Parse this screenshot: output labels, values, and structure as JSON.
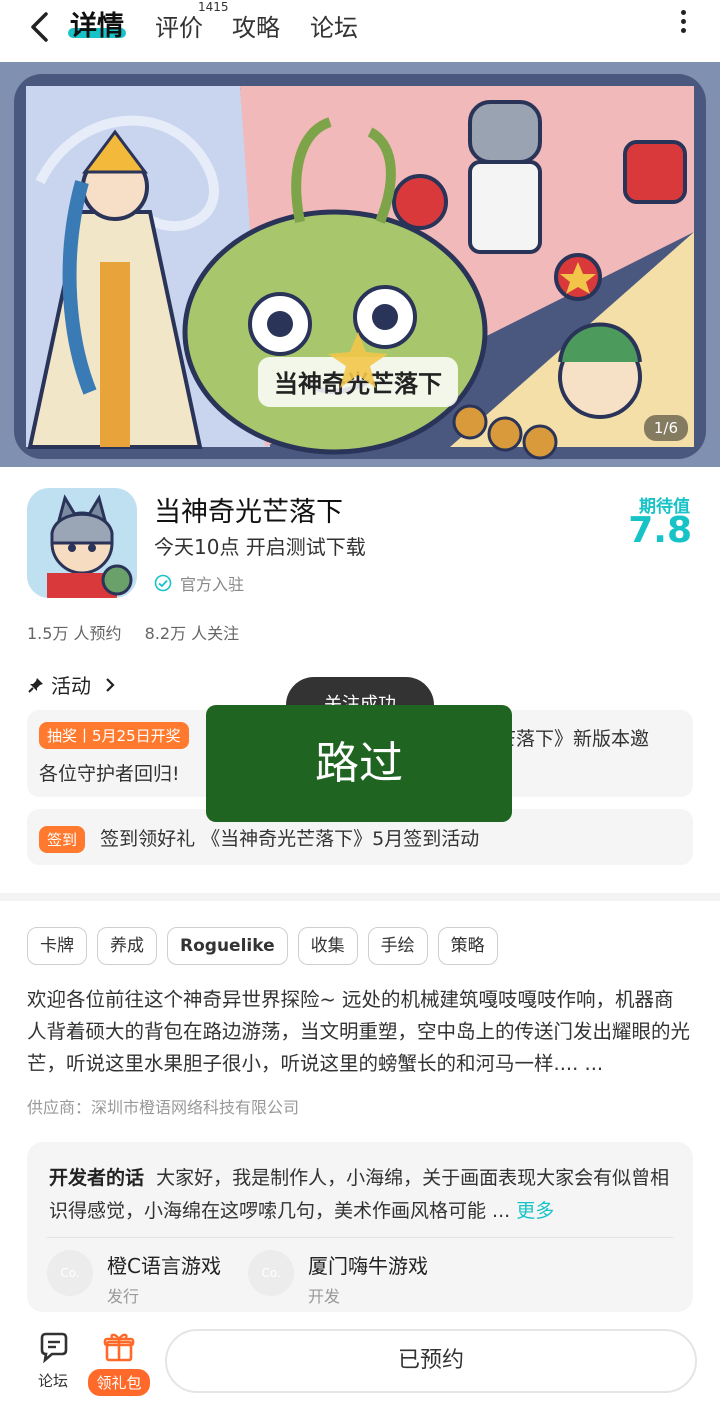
{
  "nav": {
    "tabs": [
      {
        "label": "详情",
        "active": true
      },
      {
        "label": "评价",
        "badge": "1415"
      },
      {
        "label": "攻略"
      },
      {
        "label": "论坛"
      }
    ]
  },
  "banner": {
    "logo_text": "当神奇光芒落下",
    "counter": "1/6"
  },
  "app": {
    "name": "当神奇光芒落下",
    "subtitle": "今天10点 开启测试下载",
    "official": "官方入驻",
    "score_label": "期待值",
    "score_value": "7.8",
    "stats": [
      "1.5万 人预约",
      "8.2万 人关注"
    ]
  },
  "activities": {
    "header": "活动",
    "items": [
      {
        "tag": "抽奖丨5月25日开奖",
        "text_right": "芒落下》新版本邀",
        "text_line2": "各位守护者回归!"
      },
      {
        "tag": "签到",
        "text": "签到领好礼 《当神奇光芒落下》5月签到活动"
      }
    ]
  },
  "overlays": {
    "toast": "关注成功",
    "pass": "路过"
  },
  "tags": [
    "卡牌",
    "养成",
    "Roguelike",
    "收集",
    "手绘",
    "策略"
  ],
  "description": "欢迎各位前往这个神奇异世界探险~ 远处的机械建筑嘎吱嘎吱作响，机器商人背着硕大的背包在路边游荡，当文明重塑，空中岛上的传送门发出耀眼的光芒，听说这里水果胆子很小，听说这里的螃蟹长的和河马一样.... ...",
  "vendor": "供应商：深圳市橙语网络科技有限公司",
  "developer": {
    "title": "开发者的话",
    "text": "大家好，我是制作人，小海绵，关于画面表现大家会有似曾相识得感觉，小海绵在这啰嗦几句，美术作画风格可能 ...",
    "more": "更多",
    "companies": [
      {
        "logo": "Co.",
        "name": "橙C语言游戏",
        "role": "发行"
      },
      {
        "logo": "Co.",
        "name": "厦门嗨牛游戏",
        "role": "开发"
      }
    ]
  },
  "bottom": {
    "forum": "论坛",
    "gift": "领礼包",
    "reserve": "已预约"
  },
  "colors": {
    "accent": "#18c3c8",
    "orange": "#ff7a2e",
    "pass_green": "#1f6420"
  }
}
